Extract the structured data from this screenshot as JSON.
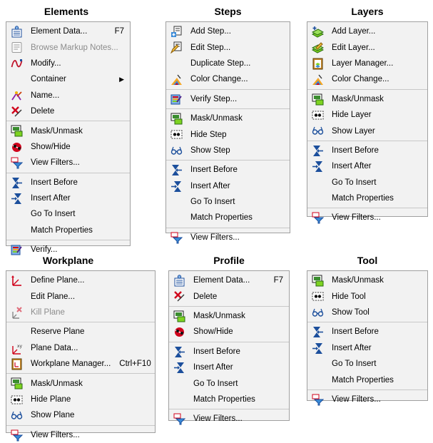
{
  "menus": [
    {
      "id": "elements",
      "title": "Elements",
      "groups": [
        [
          {
            "label": "Element Data...",
            "shortcut": "F7",
            "icon": "element-data-icon"
          },
          {
            "label": "Browse Markup Notes...",
            "icon": "markup-notes-icon",
            "disabled": true
          },
          {
            "label": "Modify...",
            "icon": "modify-icon"
          },
          {
            "label": "Container",
            "submenu": true
          },
          {
            "label": "Name...",
            "icon": "name-icon"
          },
          {
            "label": "Delete",
            "icon": "delete-icon"
          }
        ],
        [
          {
            "label": "Mask/Unmask",
            "icon": "mask-icon"
          },
          {
            "label": "Show/Hide",
            "icon": "show-hide-icon"
          },
          {
            "label": "View Filters...",
            "icon": "view-filters-icon"
          }
        ],
        [
          {
            "label": "Insert Before",
            "icon": "insert-before-icon"
          },
          {
            "label": "Insert After",
            "icon": "insert-after-icon"
          },
          {
            "label": "Go To Insert"
          },
          {
            "label": "Match Properties"
          }
        ],
        [
          {
            "label": "Verify...",
            "icon": "verify-icon"
          }
        ]
      ]
    },
    {
      "id": "steps",
      "title": "Steps",
      "groups": [
        [
          {
            "label": "Add Step...",
            "icon": "add-step-icon"
          },
          {
            "label": "Edit Step...",
            "icon": "edit-step-icon"
          },
          {
            "label": "Duplicate Step..."
          },
          {
            "label": "Color Change...",
            "icon": "color-change-icon"
          }
        ],
        [
          {
            "label": "Verify Step...",
            "icon": "verify-icon"
          }
        ],
        [
          {
            "label": "Mask/Unmask",
            "icon": "mask-icon"
          },
          {
            "label": "Hide Step",
            "icon": "hide-icon"
          },
          {
            "label": "Show Step",
            "icon": "show-icon"
          }
        ],
        [
          {
            "label": "Insert Before",
            "icon": "insert-before-icon"
          },
          {
            "label": "Insert After",
            "icon": "insert-after-icon"
          },
          {
            "label": "Go To Insert"
          },
          {
            "label": "Match Properties"
          }
        ],
        [
          {
            "label": "View Filters...",
            "icon": "view-filters-icon"
          }
        ]
      ]
    },
    {
      "id": "layers",
      "title": "Layers",
      "groups": [
        [
          {
            "label": "Add Layer...",
            "icon": "add-layer-icon"
          },
          {
            "label": "Edit Layer...",
            "icon": "edit-layer-icon"
          },
          {
            "label": "Layer Manager...",
            "icon": "layer-manager-icon"
          },
          {
            "label": "Color Change...",
            "icon": "color-change-icon"
          }
        ],
        [
          {
            "label": "Mask/Unmask",
            "icon": "mask-icon"
          },
          {
            "label": "Hide Layer",
            "icon": "hide-icon"
          },
          {
            "label": "Show Layer",
            "icon": "show-icon"
          }
        ],
        [
          {
            "label": "Insert Before",
            "icon": "insert-before-icon"
          },
          {
            "label": "Insert After",
            "icon": "insert-after-icon"
          },
          {
            "label": "Go To Insert"
          },
          {
            "label": "Match Properties"
          }
        ],
        [
          {
            "label": "View Filters...",
            "icon": "view-filters-icon"
          }
        ]
      ]
    },
    {
      "id": "workplane",
      "title": "Workplane",
      "groups": [
        [
          {
            "label": "Define Plane...",
            "icon": "define-plane-icon"
          },
          {
            "label": "Edit Plane..."
          },
          {
            "label": "Kill Plane",
            "icon": "kill-plane-icon",
            "disabled": true
          }
        ],
        [
          {
            "label": "Reserve Plane"
          },
          {
            "label": "Plane Data...",
            "icon": "plane-data-icon"
          },
          {
            "label": "Workplane Manager...",
            "shortcut": "Ctrl+F10",
            "icon": "workplane-manager-icon"
          }
        ],
        [
          {
            "label": "Mask/Unmask",
            "icon": "mask-icon"
          },
          {
            "label": "Hide Plane",
            "icon": "hide-icon"
          },
          {
            "label": "Show Plane",
            "icon": "show-icon"
          }
        ],
        [
          {
            "label": "View Filters...",
            "icon": "view-filters-icon"
          }
        ]
      ]
    },
    {
      "id": "profile",
      "title": "Profile",
      "groups": [
        [
          {
            "label": "Element Data...",
            "shortcut": "F7",
            "icon": "element-data-icon"
          },
          {
            "label": "Delete",
            "icon": "delete-icon"
          }
        ],
        [
          {
            "label": "Mask/Unmask",
            "icon": "mask-icon"
          },
          {
            "label": "Show/Hide",
            "icon": "show-hide-icon"
          }
        ],
        [
          {
            "label": "Insert Before",
            "icon": "insert-before-icon"
          },
          {
            "label": "Insert After",
            "icon": "insert-after-icon"
          },
          {
            "label": "Go To Insert"
          },
          {
            "label": "Match Properties"
          }
        ],
        [
          {
            "label": "View Filters...",
            "icon": "view-filters-icon"
          }
        ]
      ]
    },
    {
      "id": "tool",
      "title": "Tool",
      "groups": [
        [
          {
            "label": "Mask/Unmask",
            "icon": "mask-icon"
          },
          {
            "label": "Hide Tool",
            "icon": "hide-icon"
          },
          {
            "label": "Show Tool",
            "icon": "show-icon"
          }
        ],
        [
          {
            "label": "Insert Before",
            "icon": "insert-before-icon"
          },
          {
            "label": "Insert After",
            "icon": "insert-after-icon"
          },
          {
            "label": "Go To Insert"
          },
          {
            "label": "Match Properties"
          }
        ],
        [
          {
            "label": "View Filters...",
            "icon": "view-filters-icon"
          }
        ]
      ]
    }
  ]
}
